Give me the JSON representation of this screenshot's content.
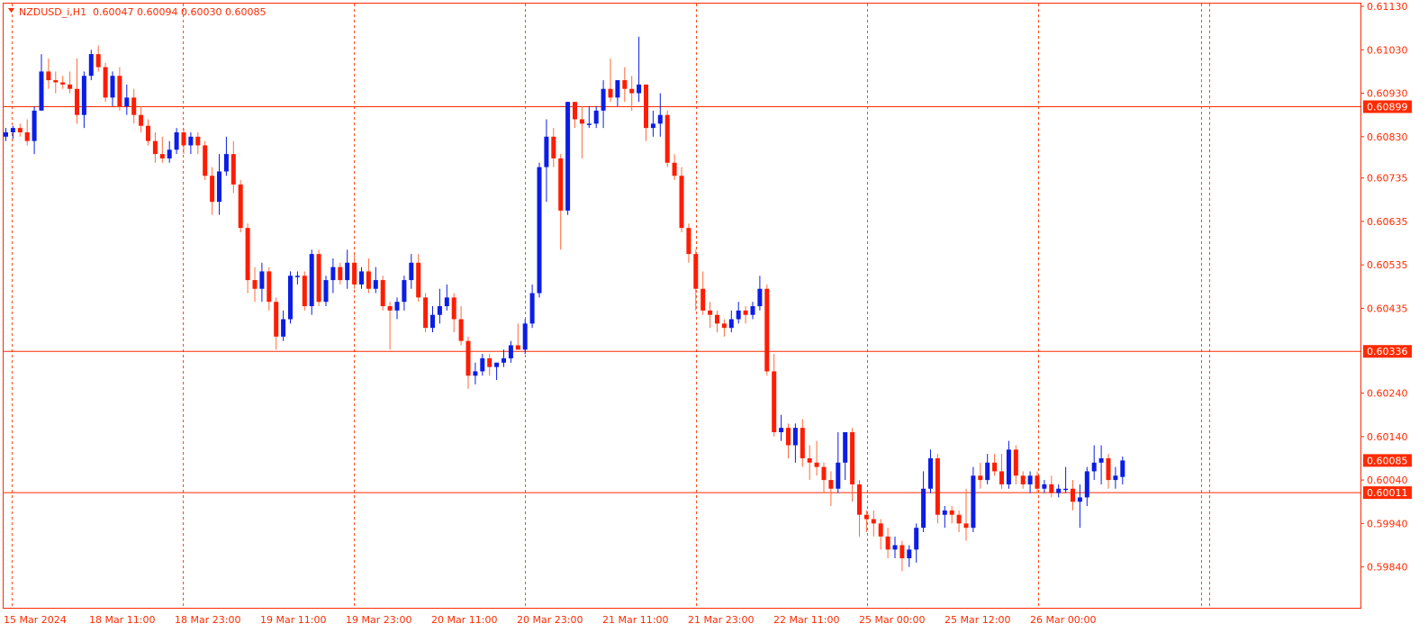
{
  "header": {
    "symbol_label": "NZDUSD_i,H1",
    "ohlc_label": "0.60047 0.60094 0.60030 0.60085"
  },
  "colors": {
    "accent": "#ff2a00",
    "grid": "#ff4a1a",
    "bull": "#0b1de6",
    "bear": "#ff1c00",
    "price_label_bg": "#ff2a00",
    "background": "#ffffff"
  },
  "chart_data": {
    "type": "candlestick",
    "title": "NZDUSD_i,H1",
    "timeframe": "H1",
    "grid": "vertical dashed",
    "last": {
      "open": 0.60047,
      "high": 0.60094,
      "low": 0.6003,
      "close": 0.60085
    },
    "y_ticks": [
      0.6113,
      0.6103,
      0.6093,
      0.6083,
      0.60735,
      0.60635,
      0.60535,
      0.60435,
      0.6024,
      0.6014,
      0.6004,
      0.5994,
      0.5984
    ],
    "y_tick_labels": [
      "0.61130",
      "0.61030",
      "0.60930",
      "0.60830",
      "0.60735",
      "0.60635",
      "0.60535",
      "0.60435",
      "0.60240",
      "0.60140",
      "0.60040",
      "0.59940",
      "0.59840"
    ],
    "ylim": [
      0.59775,
      0.6113
    ],
    "x_labels": [
      "15 Mar 2024",
      "18 Mar 11:00",
      "18 Mar 23:00",
      "19 Mar 11:00",
      "19 Mar 23:00",
      "20 Mar 11:00",
      "20 Mar 23:00",
      "21 Mar 11:00",
      "21 Mar 23:00",
      "22 Mar 11:00",
      "25 Mar 00:00",
      "25 Mar 12:00",
      "26 Mar 00:00"
    ],
    "horizontal_lines": [
      {
        "value": 0.60899,
        "label": "0.60899"
      },
      {
        "value": 0.60336,
        "label": "0.60336"
      },
      {
        "value": 0.60011,
        "label": "0.60011"
      }
    ],
    "current_price": {
      "value": 0.60085,
      "label": "0.60085"
    },
    "candles": [
      [
        0.6083,
        0.6085,
        0.6082,
        0.6084
      ],
      [
        0.6084,
        0.60855,
        0.60825,
        0.6085
      ],
      [
        0.6085,
        0.6086,
        0.6083,
        0.6084
      ],
      [
        0.6084,
        0.6087,
        0.6081,
        0.6082
      ],
      [
        0.6082,
        0.609,
        0.6079,
        0.6089
      ],
      [
        0.6089,
        0.6102,
        0.6089,
        0.6098
      ],
      [
        0.6098,
        0.6101,
        0.6094,
        0.6096
      ],
      [
        0.6096,
        0.6098,
        0.6093,
        0.60955
      ],
      [
        0.60955,
        0.6097,
        0.6094,
        0.6095
      ],
      [
        0.6095,
        0.6098,
        0.6093,
        0.6094
      ],
      [
        0.6094,
        0.6101,
        0.6086,
        0.6088
      ],
      [
        0.6088,
        0.6098,
        0.6085,
        0.6097
      ],
      [
        0.6097,
        0.6103,
        0.6096,
        0.6102
      ],
      [
        0.6102,
        0.6104,
        0.6098,
        0.6099
      ],
      [
        0.6099,
        0.61,
        0.6091,
        0.6092
      ],
      [
        0.6092,
        0.6098,
        0.609,
        0.6097
      ],
      [
        0.6097,
        0.6099,
        0.6089,
        0.609
      ],
      [
        0.609,
        0.6095,
        0.6088,
        0.6092
      ],
      [
        0.6092,
        0.6094,
        0.6086,
        0.6088
      ],
      [
        0.6088,
        0.609,
        0.6084,
        0.60855
      ],
      [
        0.60855,
        0.6087,
        0.6081,
        0.6082
      ],
      [
        0.6082,
        0.6084,
        0.6077,
        0.6079
      ],
      [
        0.6079,
        0.6083,
        0.6077,
        0.6078
      ],
      [
        0.6078,
        0.6082,
        0.6077,
        0.608
      ],
      [
        0.608,
        0.6085,
        0.6079,
        0.6084
      ],
      [
        0.6084,
        0.6085,
        0.6079,
        0.6081
      ],
      [
        0.6081,
        0.6084,
        0.6079,
        0.6083
      ],
      [
        0.6083,
        0.6084,
        0.6079,
        0.6081
      ],
      [
        0.6081,
        0.6082,
        0.6073,
        0.6074
      ],
      [
        0.6074,
        0.6076,
        0.6065,
        0.6068
      ],
      [
        0.6068,
        0.6079,
        0.6065,
        0.6075
      ],
      [
        0.6075,
        0.6083,
        0.6074,
        0.6079
      ],
      [
        0.6079,
        0.6082,
        0.607,
        0.6072
      ],
      [
        0.6072,
        0.6073,
        0.6061,
        0.6062
      ],
      [
        0.6062,
        0.6063,
        0.6047,
        0.605
      ],
      [
        0.605,
        0.6053,
        0.6045,
        0.6048
      ],
      [
        0.6048,
        0.6054,
        0.6045,
        0.6052
      ],
      [
        0.6052,
        0.6053,
        0.6043,
        0.6045
      ],
      [
        0.6045,
        0.6046,
        0.6034,
        0.6037
      ],
      [
        0.6037,
        0.6043,
        0.6036,
        0.6041
      ],
      [
        0.6041,
        0.6052,
        0.604,
        0.6051
      ],
      [
        0.6051,
        0.6052,
        0.6049,
        0.6051
      ],
      [
        0.6051,
        0.6052,
        0.6043,
        0.6044
      ],
      [
        0.6044,
        0.6057,
        0.6042,
        0.6056
      ],
      [
        0.6056,
        0.6057,
        0.6044,
        0.6045
      ],
      [
        0.6045,
        0.6051,
        0.6044,
        0.605
      ],
      [
        0.605,
        0.6055,
        0.6047,
        0.6053
      ],
      [
        0.6053,
        0.6054,
        0.6049,
        0.605
      ],
      [
        0.605,
        0.6057,
        0.6048,
        0.6054
      ],
      [
        0.6054,
        0.6056,
        0.6048,
        0.6049
      ],
      [
        0.6049,
        0.6053,
        0.6048,
        0.6052
      ],
      [
        0.6052,
        0.6055,
        0.6047,
        0.6048
      ],
      [
        0.6048,
        0.6053,
        0.6047,
        0.605
      ],
      [
        0.605,
        0.6051,
        0.6043,
        0.6044
      ],
      [
        0.6044,
        0.6045,
        0.6034,
        0.6043
      ],
      [
        0.6043,
        0.6046,
        0.6041,
        0.6045
      ],
      [
        0.6045,
        0.6051,
        0.6043,
        0.605
      ],
      [
        0.605,
        0.6056,
        0.6048,
        0.6054
      ],
      [
        0.6054,
        0.6056,
        0.6045,
        0.6046
      ],
      [
        0.6046,
        0.6047,
        0.6038,
        0.6039
      ],
      [
        0.6039,
        0.6044,
        0.6038,
        0.6042
      ],
      [
        0.6042,
        0.6048,
        0.604,
        0.6044
      ],
      [
        0.6044,
        0.6049,
        0.6043,
        0.6046
      ],
      [
        0.6046,
        0.6047,
        0.6038,
        0.6041
      ],
      [
        0.6041,
        0.6044,
        0.6035,
        0.6036
      ],
      [
        0.6036,
        0.6037,
        0.6025,
        0.6028
      ],
      [
        0.6028,
        0.6031,
        0.6026,
        0.6029
      ],
      [
        0.6029,
        0.6033,
        0.6028,
        0.6032
      ],
      [
        0.6032,
        0.6033,
        0.6028,
        0.603
      ],
      [
        0.603,
        0.6031,
        0.6027,
        0.6031
      ],
      [
        0.6031,
        0.6034,
        0.603,
        0.6032
      ],
      [
        0.6032,
        0.6036,
        0.6031,
        0.6035
      ],
      [
        0.6035,
        0.604,
        0.6034,
        0.6034
      ],
      [
        0.6034,
        0.6041,
        0.6033,
        0.604
      ],
      [
        0.604,
        0.6049,
        0.6039,
        0.6047
      ],
      [
        0.6047,
        0.6077,
        0.6046,
        0.6076
      ],
      [
        0.6076,
        0.6087,
        0.6068,
        0.6083
      ],
      [
        0.6083,
        0.6085,
        0.6076,
        0.6078
      ],
      [
        0.6078,
        0.6079,
        0.6057,
        0.6066
      ],
      [
        0.6066,
        0.6091,
        0.6065,
        0.6091
      ],
      [
        0.6091,
        0.6091,
        0.6085,
        0.6087
      ],
      [
        0.6087,
        0.609,
        0.6078,
        0.6086
      ],
      [
        0.6086,
        0.609,
        0.6085,
        0.6086
      ],
      [
        0.6086,
        0.609,
        0.6085,
        0.6089
      ],
      [
        0.6089,
        0.6096,
        0.6085,
        0.6094
      ],
      [
        0.6094,
        0.6101,
        0.6091,
        0.6092
      ],
      [
        0.6092,
        0.6096,
        0.609,
        0.6096
      ],
      [
        0.6096,
        0.6099,
        0.6091,
        0.6094
      ],
      [
        0.6094,
        0.6097,
        0.6089,
        0.6093
      ],
      [
        0.6093,
        0.6106,
        0.6091,
        0.6095
      ],
      [
        0.6095,
        0.6095,
        0.6082,
        0.6085
      ],
      [
        0.6085,
        0.6089,
        0.6083,
        0.6086
      ],
      [
        0.6086,
        0.6093,
        0.6083,
        0.6088
      ],
      [
        0.6088,
        0.6089,
        0.6076,
        0.6077
      ],
      [
        0.6077,
        0.6079,
        0.6073,
        0.6074
      ],
      [
        0.6074,
        0.6076,
        0.6061,
        0.6062
      ],
      [
        0.6062,
        0.6063,
        0.6054,
        0.6056
      ],
      [
        0.6056,
        0.6057,
        0.6043,
        0.6048
      ],
      [
        0.6048,
        0.6052,
        0.6042,
        0.6043
      ],
      [
        0.6043,
        0.6045,
        0.6039,
        0.6042
      ],
      [
        0.6042,
        0.6043,
        0.6038,
        0.604
      ],
      [
        0.604,
        0.6041,
        0.6037,
        0.6039
      ],
      [
        0.6039,
        0.6043,
        0.6038,
        0.6041
      ],
      [
        0.6041,
        0.6045,
        0.604,
        0.6043
      ],
      [
        0.6043,
        0.6044,
        0.604,
        0.6042
      ],
      [
        0.6042,
        0.6045,
        0.6041,
        0.6044
      ],
      [
        0.6044,
        0.6051,
        0.6043,
        0.6048
      ],
      [
        0.6048,
        0.6049,
        0.6028,
        0.6029
      ],
      [
        0.6029,
        0.6033,
        0.6014,
        0.6015
      ],
      [
        0.6015,
        0.6019,
        0.6013,
        0.6016
      ],
      [
        0.6016,
        0.6017,
        0.6009,
        0.6012
      ],
      [
        0.6012,
        0.6017,
        0.6008,
        0.6016
      ],
      [
        0.6016,
        0.6018,
        0.6007,
        0.6009
      ],
      [
        0.6009,
        0.6012,
        0.6004,
        0.6008
      ],
      [
        0.6008,
        0.6013,
        0.6005,
        0.6007
      ],
      [
        0.6007,
        0.6008,
        0.6001,
        0.6004
      ],
      [
        0.6004,
        0.6006,
        0.5998,
        0.6002
      ],
      [
        0.6002,
        0.6015,
        0.6001,
        0.6008
      ],
      [
        0.6008,
        0.6015,
        0.6004,
        0.6015
      ],
      [
        0.6015,
        0.6016,
        0.5999,
        0.6003
      ],
      [
        0.6003,
        0.6004,
        0.5991,
        0.5996
      ],
      [
        0.5996,
        0.5997,
        0.5992,
        0.5995
      ],
      [
        0.5995,
        0.5997,
        0.5991,
        0.5994
      ],
      [
        0.5994,
        0.5995,
        0.5988,
        0.5991
      ],
      [
        0.5991,
        0.5993,
        0.5986,
        0.5988
      ],
      [
        0.5988,
        0.5991,
        0.5986,
        0.5989
      ],
      [
        0.5989,
        0.599,
        0.5983,
        0.5986
      ],
      [
        0.5986,
        0.5989,
        0.5984,
        0.5988
      ],
      [
        0.5988,
        0.5994,
        0.5985,
        0.5993
      ],
      [
        0.5993,
        0.6006,
        0.5992,
        0.6002
      ],
      [
        0.6002,
        0.6011,
        0.6001,
        0.6009
      ],
      [
        0.6009,
        0.601,
        0.5994,
        0.5996
      ],
      [
        0.5996,
        0.5998,
        0.5993,
        0.5997
      ],
      [
        0.5997,
        0.5998,
        0.5994,
        0.5996
      ],
      [
        0.5996,
        0.5997,
        0.5992,
        0.5994
      ],
      [
        0.5994,
        0.6002,
        0.599,
        0.5993
      ],
      [
        0.5993,
        0.6007,
        0.5992,
        0.6005
      ],
      [
        0.6005,
        0.6008,
        0.6002,
        0.6004
      ],
      [
        0.6004,
        0.601,
        0.6003,
        0.6008
      ],
      [
        0.6008,
        0.601,
        0.6005,
        0.6006
      ],
      [
        0.6006,
        0.601,
        0.6002,
        0.6003
      ],
      [
        0.6003,
        0.6013,
        0.6002,
        0.6011
      ],
      [
        0.6011,
        0.6012,
        0.6003,
        0.6005
      ],
      [
        0.6005,
        0.6006,
        0.6002,
        0.6003
      ],
      [
        0.6003,
        0.6006,
        0.6001,
        0.6005
      ],
      [
        0.6005,
        0.6006,
        0.6001,
        0.6002
      ],
      [
        0.6002,
        0.6004,
        0.6001,
        0.6003
      ],
      [
        0.6003,
        0.6005,
        0.6,
        0.6001
      ],
      [
        0.6001,
        0.6003,
        0.6,
        0.6002
      ],
      [
        0.6002,
        0.6007,
        0.6001,
        0.6002
      ],
      [
        0.6002,
        0.6004,
        0.5997,
        0.5999
      ],
      [
        0.5999,
        0.6003,
        0.5993,
        0.6
      ],
      [
        0.6,
        0.6007,
        0.5998,
        0.6006
      ],
      [
        0.6006,
        0.6012,
        0.6004,
        0.6008
      ],
      [
        0.6008,
        0.6012,
        0.6003,
        0.6009
      ],
      [
        0.6009,
        0.601,
        0.6002,
        0.6004
      ],
      [
        0.6004,
        0.6007,
        0.6002,
        0.6005
      ],
      [
        0.60047,
        0.60094,
        0.6003,
        0.60085
      ]
    ]
  }
}
